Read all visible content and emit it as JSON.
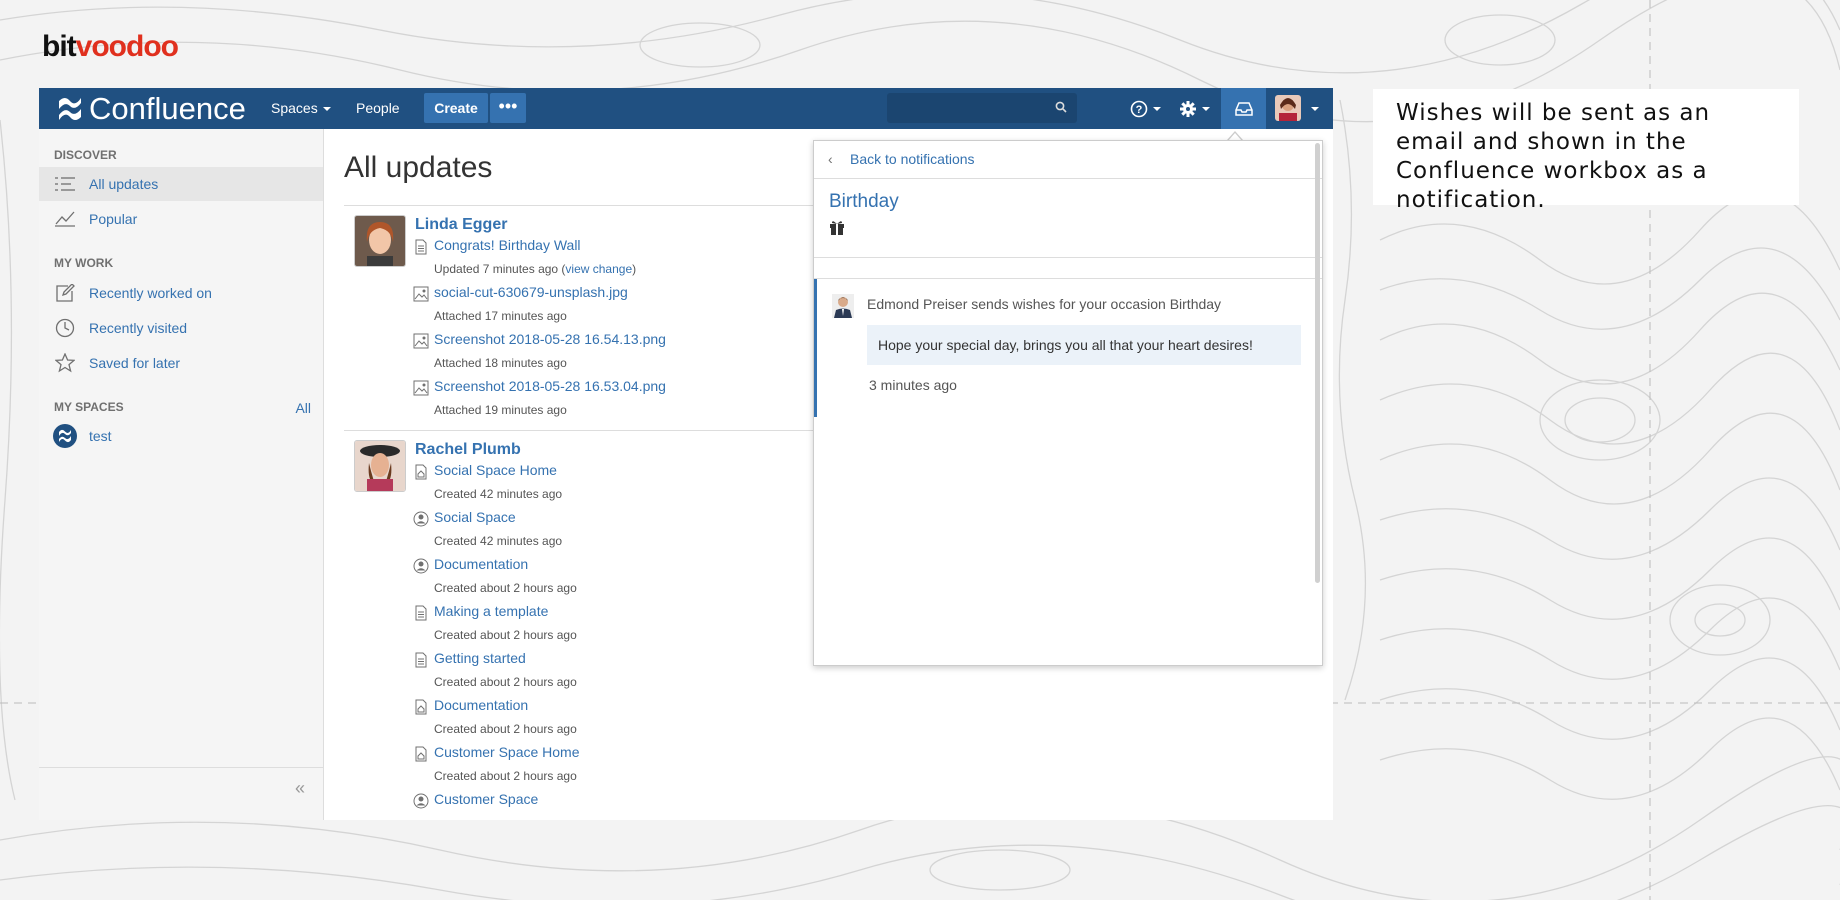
{
  "brand": {
    "part1": "bit",
    "part2": "voodoo"
  },
  "navbar": {
    "product": "Confluence",
    "spaces": "Spaces",
    "people": "People",
    "create": "Create",
    "more": "•••"
  },
  "sidebar": {
    "discover_heading": "DISCOVER",
    "discover_items": [
      {
        "label": "All updates",
        "icon": "list-icon"
      },
      {
        "label": "Popular",
        "icon": "trend-icon"
      }
    ],
    "mywork_heading": "MY WORK",
    "mywork_items": [
      {
        "label": "Recently worked on",
        "icon": "edit-icon"
      },
      {
        "label": "Recently visited",
        "icon": "clock-icon"
      },
      {
        "label": "Saved for later",
        "icon": "star-icon"
      }
    ],
    "myspaces_heading": "MY SPACES",
    "myspaces_all": "All",
    "spaces": [
      {
        "label": "test"
      }
    ],
    "collapse": "«"
  },
  "main": {
    "title": "All updates",
    "groups": [
      {
        "user": "Linda Egger",
        "activities": [
          {
            "type": "page",
            "title": "Congrats! Birthday Wall",
            "meta": "Updated 7 minutes ago (",
            "meta_link": "view change",
            "meta_end": ")"
          },
          {
            "type": "image",
            "title": "social-cut-630679-unsplash.jpg",
            "meta": "Attached 17 minutes ago"
          },
          {
            "type": "image",
            "title": "Screenshot 2018-05-28 16.54.13.png",
            "meta": "Attached 18 minutes ago"
          },
          {
            "type": "image",
            "title": "Screenshot 2018-05-28 16.53.04.png",
            "meta": "Attached 19 minutes ago"
          }
        ]
      },
      {
        "user": "Rachel Plumb",
        "activities": [
          {
            "type": "home",
            "title": "Social Space Home",
            "meta": "Created 42 minutes ago"
          },
          {
            "type": "space",
            "title": "Social Space",
            "meta": "Created 42 minutes ago"
          },
          {
            "type": "space",
            "title": "Documentation",
            "meta": "Created about 2 hours ago"
          },
          {
            "type": "page",
            "title": "Making a template",
            "meta": "Created about 2 hours ago"
          },
          {
            "type": "page",
            "title": "Getting started",
            "meta": "Created about 2 hours ago"
          },
          {
            "type": "home",
            "title": "Documentation",
            "meta": "Created about 2 hours ago"
          },
          {
            "type": "home",
            "title": "Customer Space Home",
            "meta": "Created about 2 hours ago"
          },
          {
            "type": "space",
            "title": "Customer Space",
            "meta": ""
          }
        ]
      }
    ]
  },
  "notification": {
    "back": "Back to notifications",
    "title": "Birthday",
    "sender": "Edmond Preiser sends wishes for your occasion Birthday",
    "message": "Hope your special day, brings you all that your heart desires!",
    "time": "3 minutes ago"
  },
  "caption": "Wishes will be sent as an email and shown in the Confluence workbox as a notification.",
  "colors": {
    "navbar": "#205081",
    "link": "#3572b0",
    "brand_red": "#e0301e"
  }
}
